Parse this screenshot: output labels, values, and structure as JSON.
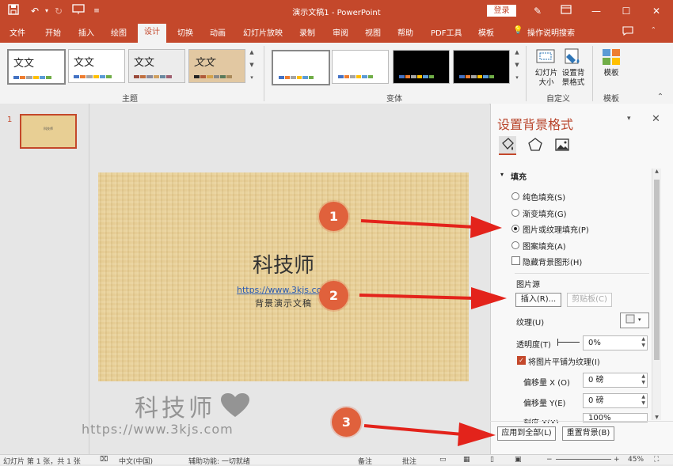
{
  "titlebar": {
    "title": "演示文稿1 - PowerPoint",
    "login": "登录",
    "minimize": "—",
    "maximize": "☐",
    "close": "✕"
  },
  "tabs": [
    "文件",
    "开始",
    "插入",
    "绘图",
    "设计",
    "切换",
    "动画",
    "幻灯片放映",
    "录制",
    "审阅",
    "视图",
    "帮助",
    "PDF工具",
    "模板"
  ],
  "active_tab": "设计",
  "tell_me": "操作说明搜索",
  "ribbon": {
    "theme_sample": "文文",
    "themes_group": "主题",
    "variants_group": "变体",
    "customize_group": "自定义",
    "template_group": "模板",
    "slide_size": "幻灯片\n大小",
    "format_bg": "设置背\n景格式",
    "template_btn": "模板"
  },
  "thumbnails": {
    "number": "1"
  },
  "slide": {
    "title": "科技师",
    "link": "https://www.3kjs.com",
    "subtitle": "背景演示文稿"
  },
  "watermark": {
    "text": "科技师",
    "url": "https://www.3kjs.com"
  },
  "pane": {
    "title": "设置背景格式",
    "fill_section": "填充",
    "options": [
      "纯色填充(S)",
      "渐变填充(G)",
      "图片或纹理填充(P)",
      "图案填充(A)"
    ],
    "selected_option": "图片或纹理填充(P)",
    "hide_bg": "隐藏背景图形(H)",
    "picture_source": "图片源",
    "insert_btn": "插入(R)...",
    "clipboard_btn": "剪贴板(C)",
    "texture_label": "纹理(U)",
    "transparency_label": "透明度(T)",
    "transparency_value": "0%",
    "tile_label": "将图片平铺为纹理(I)",
    "offset_x_label": "偏移量 X (O)",
    "offset_x_value": "0 磅",
    "offset_y_label": "偏移量 Y(E)",
    "offset_y_value": "0 磅",
    "scale_x_label": "刻度 X(X)",
    "scale_x_value": "100%",
    "apply_all": "应用到全部(L)",
    "reset_bg": "重置背景(B)"
  },
  "callouts": [
    "1",
    "2",
    "3"
  ],
  "status": {
    "slide_info": "幻灯片 第 1 张，共 1 张",
    "language": "中文(中国)",
    "accessibility": "辅助功能: 一切就绪",
    "notes": "备注",
    "comments": "批注",
    "zoom": "45%"
  },
  "colors": {
    "accent": "#c4482b",
    "callout": "#e0613c",
    "arrow": "#e3231b",
    "slide_bg": "#e8cf94"
  }
}
